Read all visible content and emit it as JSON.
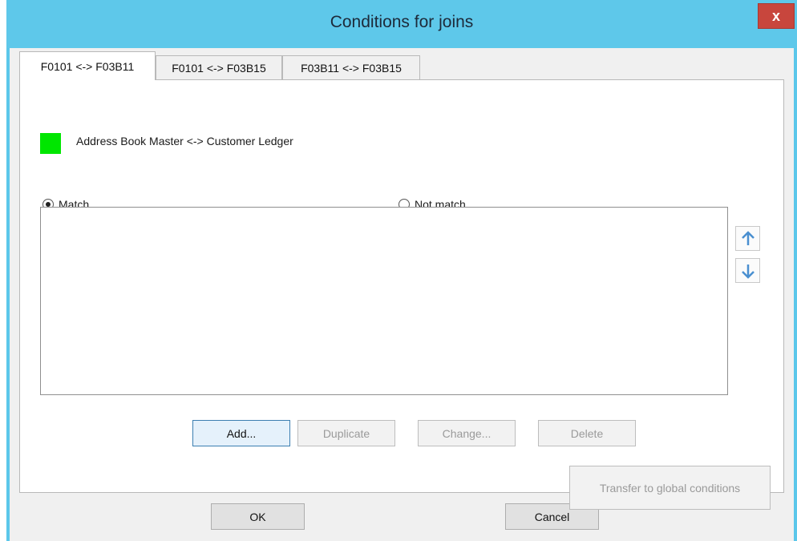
{
  "window": {
    "title": "Conditions for joins",
    "close_label": "x"
  },
  "tabs": [
    {
      "label": "F0101 <-> F03B11",
      "active": true
    },
    {
      "label": "F0101 <-> F03B15",
      "active": false
    },
    {
      "label": "F03B11 <-> F03B15",
      "active": false
    }
  ],
  "join": {
    "color": "#00e600",
    "label": "Address Book Master <-> Customer Ledger"
  },
  "options": {
    "match_label": "Match",
    "not_match_label": "Not match",
    "selected": "Match"
  },
  "conditions": [],
  "icons": {
    "move_up": "arrow-up-icon",
    "move_down": "arrow-down-icon"
  },
  "buttons": {
    "add": "Add...",
    "duplicate": "Duplicate",
    "change": "Change...",
    "delete": "Delete",
    "transfer": "Transfer to global conditions",
    "ok": "OK",
    "cancel": "Cancel"
  }
}
